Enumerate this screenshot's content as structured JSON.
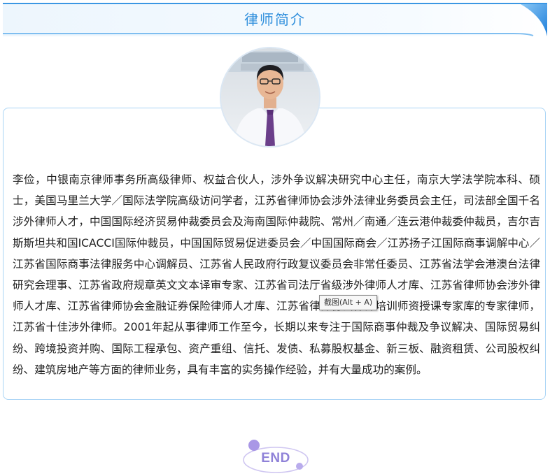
{
  "header": {
    "title": "律师简介"
  },
  "profile": {
    "bio": "李俭，中银南京律师事务所高级律师、权益合伙人，涉外争议解决研究中心主任，南京大学法学院本科、硕士，美国马里兰大学／国际法学院高级访问学者，江苏省律师协会涉外法律业务委员会主任，司法部全国千名涉外律师人才，中国国际经济贸易仲裁委员会及海南国际仲裁院、常州／南通／连云港仲裁委仲裁员，吉尔吉斯斯坦共和国ICACCI国际仲裁员，中国国际贸易促进委员会／中国国际商会／江苏扬子江国际商事调解中心／江苏省国际商事法律服务中心调解员、江苏省人民政府行政复议委员会非常任委员、江苏省法学会港澳台法律研究会理事、江苏省政府规章英文文本译审专家、江苏省司法厅省级涉外律师人才库、江苏省律师协会涉外律师人才库、江苏省律师协会金融证券保险律师人才库、江苏省律师协会律师培训师资授课专家库的专家律师，江苏省十佳涉外律师。2001年起从事律师工作至今，长期以来专注于国际商事仲裁及争议解决、国际贸易纠纷、跨境投资并购、国际工程承包、资产重组、信托、发债、私募股权基金、新三板、融资租赁、公司股权纠纷、建筑房地产等方面的律师业务，具有丰富的实务操作经验，并有大量成功的案例。"
  },
  "tooltip": {
    "text": "截图(Alt + A)"
  },
  "footer": {
    "end_label": "END"
  },
  "colors": {
    "accent_blue": "#2f8fdc",
    "card_border": "#a9d4f5",
    "end_purple": "#8f82d8"
  }
}
